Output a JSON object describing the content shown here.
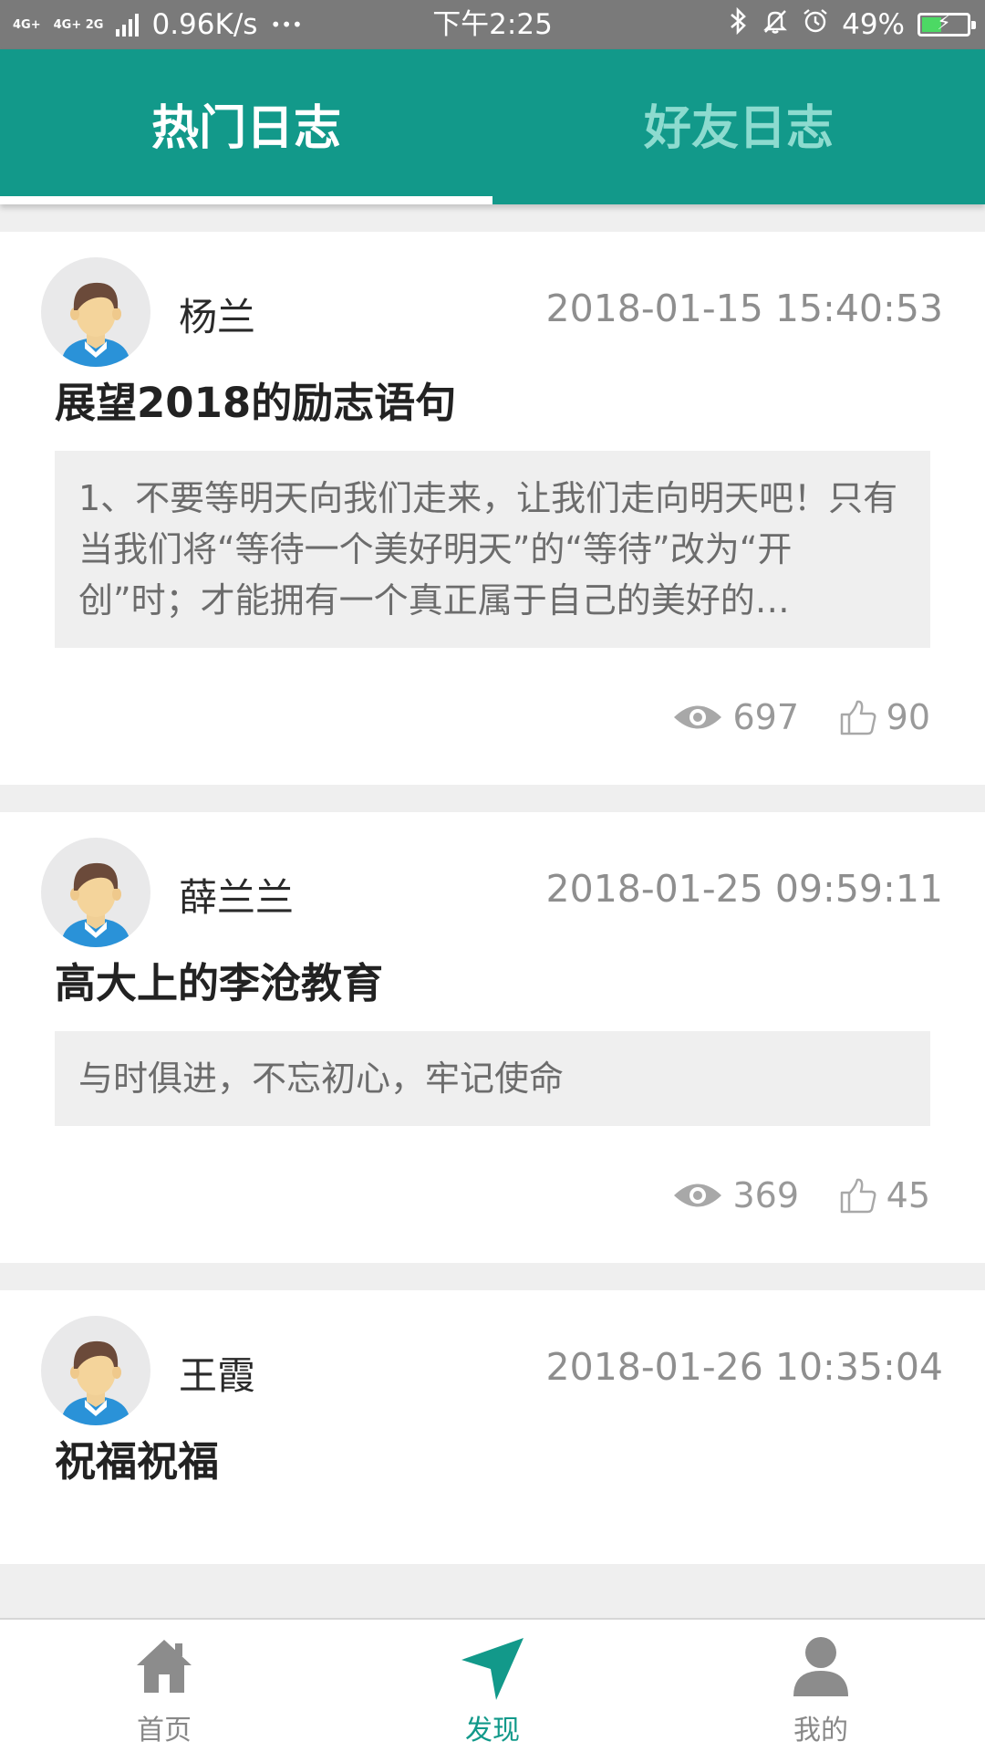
{
  "status_bar": {
    "network_1": "4G+",
    "network_2": "4G+ 2G",
    "speed": "0.96K/s",
    "more": "•••",
    "time": "下午2:25",
    "battery_percent": "49%",
    "battery_level": 0.49,
    "icons": [
      "bluetooth-icon",
      "bell-off-icon",
      "alarm-icon",
      "battery-charging-icon"
    ]
  },
  "tabs": [
    {
      "label": "热门日志",
      "active": true
    },
    {
      "label": "好友日志",
      "active": false
    }
  ],
  "colors": {
    "accent": "#12998a",
    "inactive_tab": "#8ddbcf"
  },
  "posts": [
    {
      "author": "杨兰",
      "date": "2018-01-15 15:40:53",
      "title": "展望2018的励志语句",
      "excerpt": "1、不要等明天向我们走来，让我们走向明天吧！只有当我们将“等待一个美好明天”的“等待”改为“开创”时；才能拥有一个真正属于自己的美好的…",
      "views": "697",
      "likes": "90"
    },
    {
      "author": "薛兰兰",
      "date": "2018-01-25 09:59:11",
      "title": "高大上的李沧教育",
      "excerpt": "与时俱进，不忘初心，牢记使命",
      "views": "369",
      "likes": "45"
    },
    {
      "author": "王霞",
      "date": "2018-01-26 10:35:04",
      "title": "祝福祝福"
    }
  ],
  "bottom_nav": [
    {
      "label": "首页",
      "icon": "home-icon",
      "active": false
    },
    {
      "label": "发现",
      "icon": "discover-icon",
      "active": true
    },
    {
      "label": "我的",
      "icon": "profile-icon",
      "active": false
    }
  ]
}
